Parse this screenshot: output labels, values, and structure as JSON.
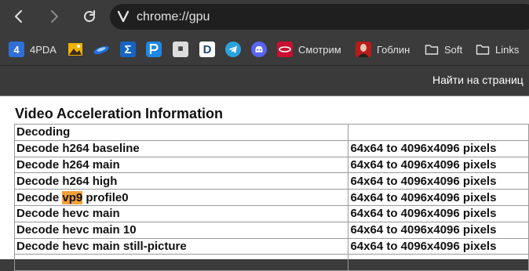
{
  "toolbar": {
    "back_icon": "arrow-left-icon",
    "forward_icon": "arrow-right-icon",
    "reload_icon": "reload-icon",
    "site_icon": "vivaldi-icon",
    "url": "chrome://gpu"
  },
  "bookmarks": [
    {
      "label": "4PDA",
      "icon": "4pda-icon",
      "color": "#2f6fd6"
    },
    {
      "label": "",
      "icon": "image-icon",
      "color": "#f0b400"
    },
    {
      "label": "",
      "icon": "planet-icon",
      "color": "#1f6fe0"
    },
    {
      "label": "",
      "icon": "sigma-icon",
      "color": "#1565c0"
    },
    {
      "label": "",
      "icon": "p-icon",
      "color": "#1e88e5"
    },
    {
      "label": "",
      "icon": "site-icon",
      "color": "#cccccc"
    },
    {
      "label": "",
      "icon": "d-icon",
      "color": "#ffffff"
    },
    {
      "label": "",
      "icon": "telegram-icon",
      "color": "#2aa3dd"
    },
    {
      "label": "",
      "icon": "discord-icon",
      "color": "#5865f2"
    },
    {
      "label": "Смотрим",
      "icon": "smotrim-icon",
      "color": "#c8102e"
    },
    {
      "label": "Гоблин",
      "icon": "goblin-icon",
      "color": "#b71c1c"
    },
    {
      "label": "Soft",
      "icon": "folder-icon",
      "color": "#e3e3e3"
    },
    {
      "label": "Links",
      "icon": "folder-icon",
      "color": "#e3e3e3"
    }
  ],
  "findbar": {
    "text": "Найти на страниц"
  },
  "section": {
    "title": "Video Acceleration Information"
  },
  "table": {
    "rows": [
      {
        "pre": "Decoding",
        "hl": "",
        "post": "",
        "value": ""
      },
      {
        "pre": "Decode h264 baseline",
        "hl": "",
        "post": "",
        "value": "64x64 to 4096x4096 pixels"
      },
      {
        "pre": "Decode h264 main",
        "hl": "",
        "post": "",
        "value": "64x64 to 4096x4096 pixels"
      },
      {
        "pre": "Decode h264 high",
        "hl": "",
        "post": "",
        "value": "64x64 to 4096x4096 pixels"
      },
      {
        "pre": "Decode ",
        "hl": "vp9",
        "post": " profile0",
        "value": "64x64 to 4096x4096 pixels"
      },
      {
        "pre": "Decode hevc main",
        "hl": "",
        "post": "",
        "value": "64x64 to 4096x4096 pixels"
      },
      {
        "pre": "Decode hevc main 10",
        "hl": "",
        "post": "",
        "value": "64x64 to 4096x4096 pixels"
      },
      {
        "pre": "Decode hevc main still-picture",
        "hl": "",
        "post": "",
        "value": "64x64 to 4096x4096 pixels"
      },
      {
        "pre": "",
        "hl": "",
        "post": "",
        "value": ""
      }
    ]
  }
}
